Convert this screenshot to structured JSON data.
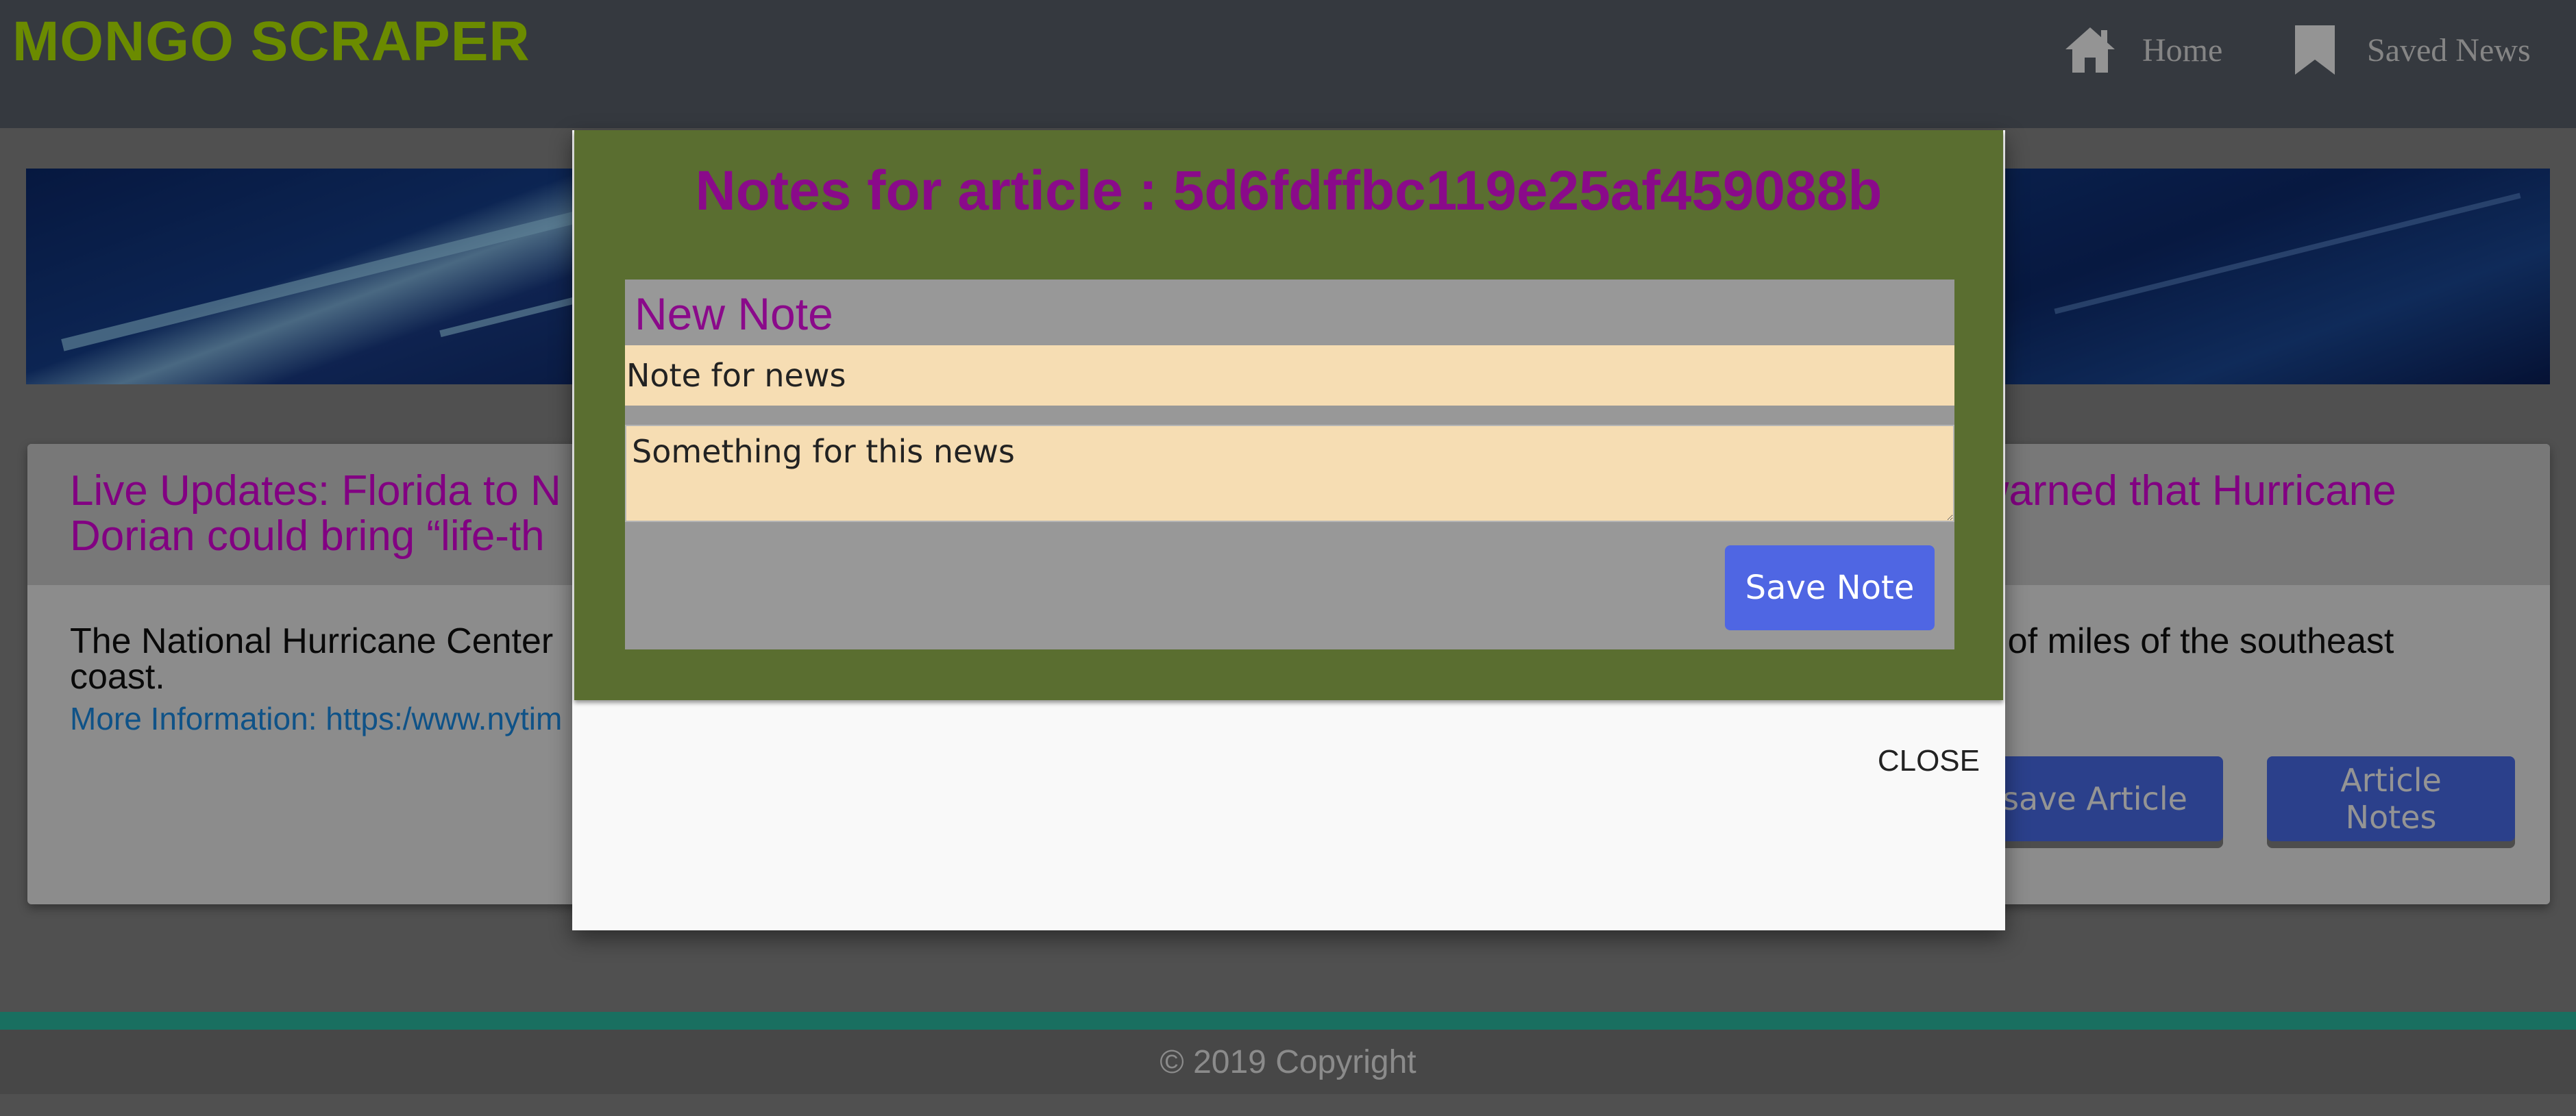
{
  "navbar": {
    "brand": "MONGO SCRAPER",
    "home_label": "Home",
    "saved_label": "Saved News",
    "home_icon": "home-icon",
    "saved_icon": "bookmark-icon"
  },
  "article": {
    "title": "Live Updates: Florida to N",
    "title_line2": "Dorian could bring “life-th",
    "title_right": "r warned that Hurricane",
    "summary": "The National Hurricane Center",
    "summary_right": "s of miles of the southeast",
    "summary_line2": "coast.",
    "link_text": "More Information: https:/www.nytim",
    "unsave_label": "save Article",
    "notes_label": "Article Notes"
  },
  "footer": {
    "copyright": "© 2019 Copyright"
  },
  "modal": {
    "title": "Notes for article : 5d6fdffbc119e25af459088b",
    "new_note_heading": "New Note",
    "note_title_value": "Note for news",
    "note_body_value": "Something for this news",
    "save_label": "Save Note",
    "close_label": "CLOSE"
  },
  "colors": {
    "brand": "#b9f000",
    "modal_header": "#5a6e30",
    "title_purple": "#8a0a8a",
    "button_blue": "#4f66e3",
    "input_bg": "#f6ddb3"
  }
}
